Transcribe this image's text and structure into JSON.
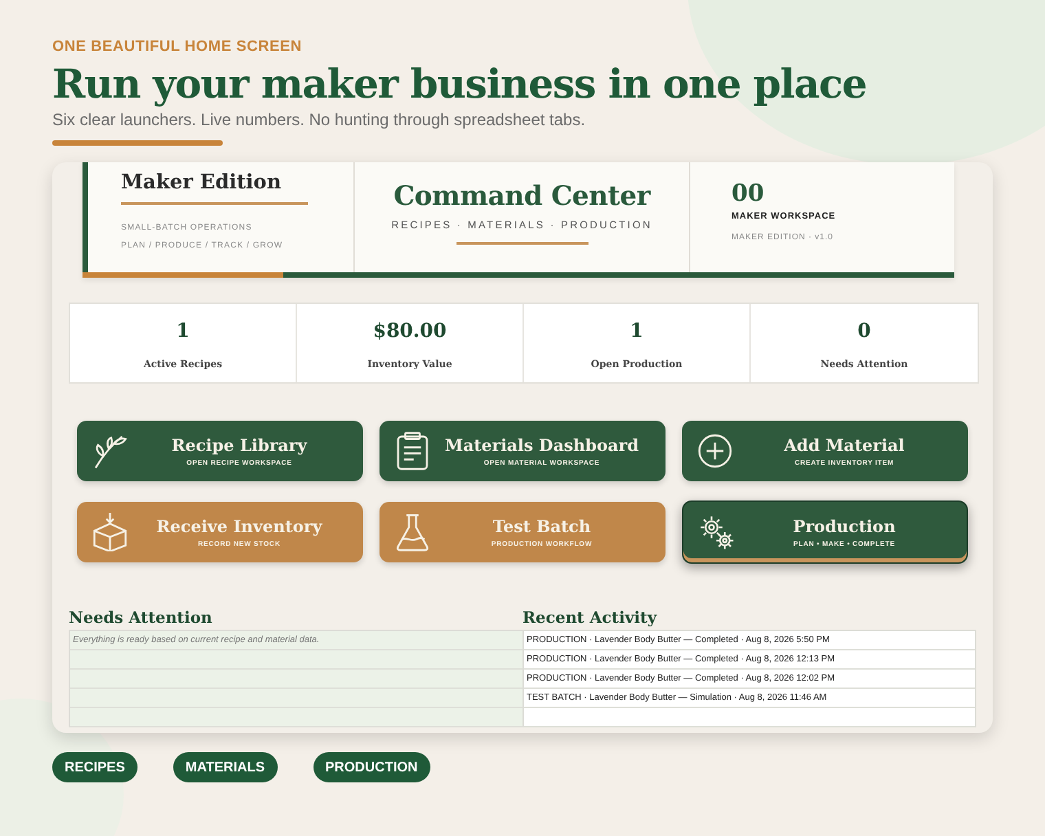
{
  "eyebrow": "ONE BEAUTIFUL HOME SCREEN",
  "headline": "Run your maker business in one place",
  "subtitle": "Six clear launchers. Live numbers. No hunting through spreadsheet tabs.",
  "banner": {
    "edition_title": "Maker Edition",
    "edition_lines": [
      "SMALL-BATCH OPERATIONS",
      "PLAN / PRODUCE / TRACK / GROW"
    ],
    "title": "Command Center",
    "tagline": "RECIPES · MATERIALS · PRODUCTION",
    "badge": "00",
    "workspace": "MAKER WORKSPACE",
    "version": "MAKER EDITION · v1.0",
    "level": 0.23
  },
  "stats": [
    {
      "value": "1",
      "label": "Active Recipes"
    },
    {
      "value": "$80.00",
      "label": "Inventory Value"
    },
    {
      "value": "1",
      "label": "Open Production"
    },
    {
      "value": "0",
      "label": "Needs Attention"
    }
  ],
  "launchers": [
    {
      "kind": "sprig",
      "title": "Recipe Library",
      "subtitle": "OPEN RECIPE WORKSPACE",
      "color": "#2f5a3d",
      "selected": false
    },
    {
      "kind": "clipboard",
      "title": "Materials Dashboard",
      "subtitle": "OPEN MATERIAL WORKSPACE",
      "color": "#2f5a3d",
      "selected": false
    },
    {
      "kind": "plus",
      "title": "Add Material",
      "subtitle": "CREATE INVENTORY ITEM",
      "color": "#2f5a3d",
      "selected": false
    },
    {
      "kind": "box",
      "title": "Receive Inventory",
      "subtitle": "RECORD NEW STOCK",
      "color": "#c0874a",
      "selected": false
    },
    {
      "kind": "flask",
      "title": "Test Batch",
      "subtitle": "PRODUCTION WORKFLOW",
      "color": "#c0874a",
      "selected": false
    },
    {
      "kind": "gears",
      "title": "Production",
      "subtitle": "PLAN • MAKE • COMPLETE",
      "color": "#2f5a3d",
      "selected": true
    }
  ],
  "needs_attention": {
    "title": "Needs Attention",
    "rows": [
      "Everything is ready based on current recipe and material data."
    ]
  },
  "recent_activity": {
    "title": "Recent Activity",
    "rows": [
      "PRODUCTION · Lavender Body Butter — Completed · Aug 8, 2026 5:50 PM",
      "PRODUCTION · Lavender Body Butter — Completed · Aug 8, 2026 12:13 PM",
      "PRODUCTION · Lavender Body Butter — Completed · Aug 8, 2026 12:02 PM",
      "TEST BATCH · Lavender Body Butter — Simulation · Aug 8, 2026 11:46 AM"
    ]
  },
  "tabs": [
    "RECIPES",
    "MATERIALS",
    "PRODUCTION"
  ]
}
